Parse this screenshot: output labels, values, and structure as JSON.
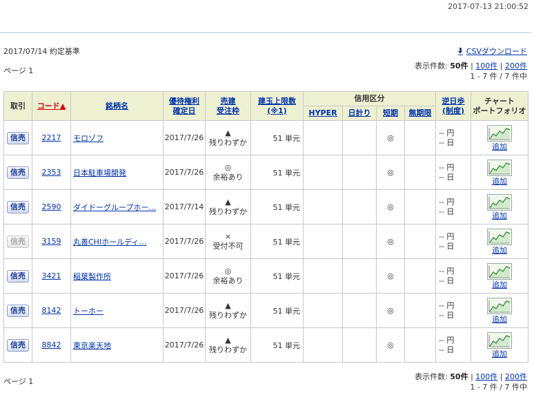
{
  "timestamp": "2017-07-13 21:00:52",
  "basis": "2017/07/14 約定基準",
  "csv_label": "CSVダウンロード",
  "page_label": "ページ 1",
  "count": {
    "prefix": "表示件数: ",
    "current": "50件",
    "sep1": " | ",
    "opt1": "100件",
    "sep2": " | ",
    "opt2": "200件",
    "range": "1 - 7 件 / 7 件中"
  },
  "headers": {
    "torihiki": "取引",
    "code": "コード▲",
    "name": "銘柄名",
    "yuutai1": "優待権利",
    "yuutai2": "確定日",
    "urikate1": "売建",
    "urikate2": "受注枠",
    "tategyoku1": "建玉上限数",
    "tategyoku2": "(※1)",
    "shinyou": "信用区分",
    "hyper": "HYPER",
    "nichigake": "日計り",
    "tanki": "短期",
    "museigen": "無期限",
    "gyakuhibu1": "逆日歩",
    "gyakuhibu2": "(制度)",
    "chart1": "チャート",
    "chart2": "ポートフォリオ"
  },
  "rows": [
    {
      "btn": "信売",
      "enabled": true,
      "code": "2217",
      "name": "モロゾフ",
      "date": "2017/7/26",
      "mark": "▲",
      "status": "残りわずか",
      "limit": "51 単元",
      "hyper": "",
      "nichi": "",
      "tanki": "◎",
      "mu": "",
      "yen": "-- 円",
      "day": "-- 日",
      "add": "追加"
    },
    {
      "btn": "信売",
      "enabled": true,
      "code": "2353",
      "name": "日本駐車場開発",
      "date": "2017/7/26",
      "mark": "◎",
      "status": "余裕あり",
      "limit": "51 単元",
      "hyper": "",
      "nichi": "",
      "tanki": "◎",
      "mu": "",
      "yen": "-- 円",
      "day": "-- 日",
      "add": "追加"
    },
    {
      "btn": "信売",
      "enabled": true,
      "code": "2590",
      "name": "ダイドーグループホー…",
      "date": "2017/7/14",
      "mark": "▲",
      "status": "残りわずか",
      "limit": "51 単元",
      "hyper": "",
      "nichi": "",
      "tanki": "◎",
      "mu": "",
      "yen": "-- 円",
      "day": "-- 日",
      "add": "追加"
    },
    {
      "btn": "信売",
      "enabled": false,
      "code": "3159",
      "name": "丸善CHIホールディ…",
      "date": "2017/7/26",
      "mark": "×",
      "status": "受付不可",
      "limit": "51 単元",
      "hyper": "",
      "nichi": "",
      "tanki": "◎",
      "mu": "",
      "yen": "-- 円",
      "day": "-- 日",
      "add": "追加"
    },
    {
      "btn": "信売",
      "enabled": true,
      "code": "3421",
      "name": "稲葉製作所",
      "date": "2017/7/26",
      "mark": "◎",
      "status": "余裕あり",
      "limit": "51 単元",
      "hyper": "",
      "nichi": "",
      "tanki": "◎",
      "mu": "",
      "yen": "-- 円",
      "day": "-- 日",
      "add": "追加"
    },
    {
      "btn": "信売",
      "enabled": true,
      "code": "8142",
      "name": "トーホー",
      "date": "2017/7/26",
      "mark": "▲",
      "status": "残りわずか",
      "limit": "51 単元",
      "hyper": "",
      "nichi": "",
      "tanki": "◎",
      "mu": "",
      "yen": "-- 円",
      "day": "-- 日",
      "add": "追加"
    },
    {
      "btn": "信売",
      "enabled": true,
      "code": "8842",
      "name": "東京楽天地",
      "date": "2017/7/26",
      "mark": "▲",
      "status": "残りわずか",
      "limit": "51 単元",
      "hyper": "",
      "nichi": "",
      "tanki": "◎",
      "mu": "",
      "yen": "-- 円",
      "day": "-- 日",
      "add": "追加"
    }
  ]
}
